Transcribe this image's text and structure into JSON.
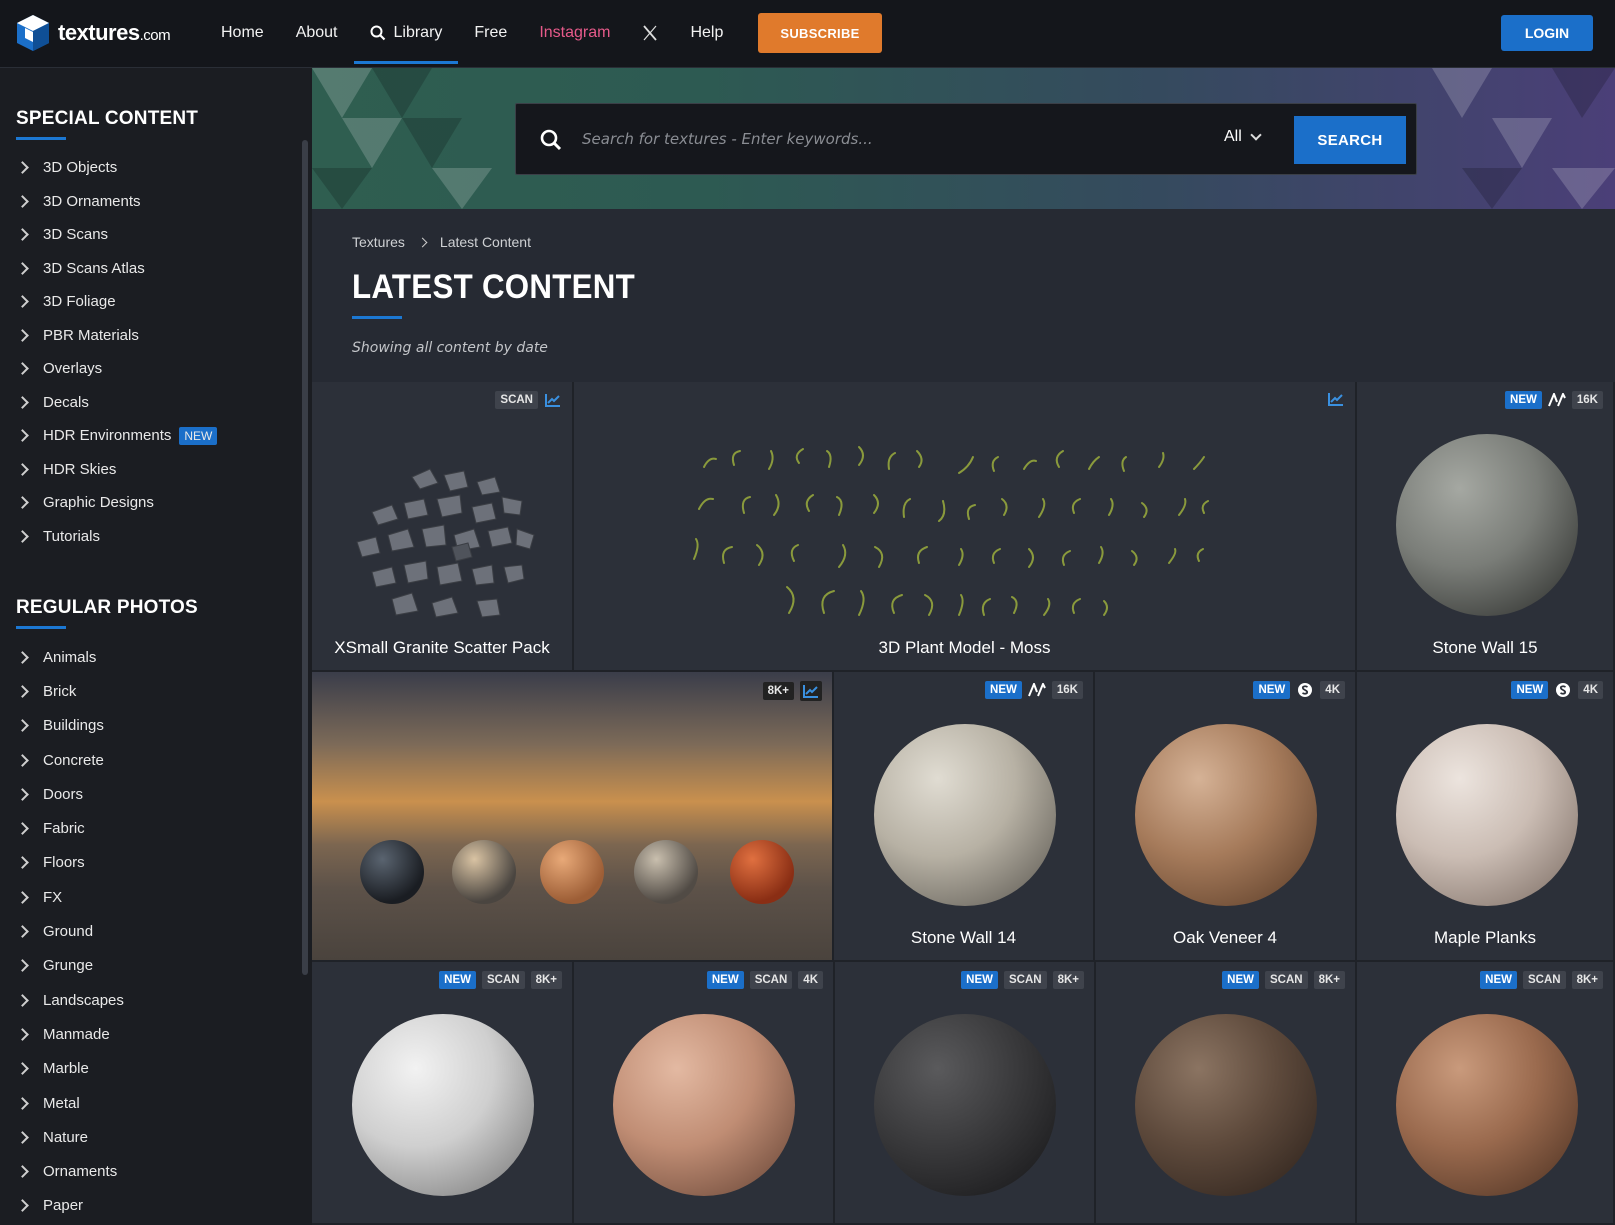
{
  "header": {
    "logo_text": "textures",
    "logo_suffix": ".com",
    "nav": [
      "Home",
      "About",
      "Library",
      "Free",
      "Instagram",
      "X",
      "Help"
    ],
    "subscribe_label": "SUBSCRIBE",
    "login_label": "LOGIN",
    "active_nav": "Library"
  },
  "sidebar": {
    "special_heading": "SPECIAL CONTENT",
    "special_items": [
      "3D Objects",
      "3D Ornaments",
      "3D Scans",
      "3D Scans Atlas",
      "3D Foliage",
      "PBR Materials",
      "Overlays",
      "Decals",
      "HDR Environments",
      "HDR Skies",
      "Graphic Designs",
      "Tutorials"
    ],
    "hdr_env_badge": "NEW",
    "regular_heading": "REGULAR PHOTOS",
    "regular_items": [
      "Animals",
      "Brick",
      "Buildings",
      "Concrete",
      "Doors",
      "Fabric",
      "Floors",
      "FX",
      "Ground",
      "Grunge",
      "Landscapes",
      "Manmade",
      "Marble",
      "Metal",
      "Nature",
      "Ornaments",
      "Paper"
    ]
  },
  "search": {
    "placeholder": "Search for textures - Enter keywords...",
    "scope": "All",
    "button_label": "SEARCH"
  },
  "breadcrumb": [
    "Textures",
    "Latest Content"
  ],
  "page": {
    "title": "LATEST CONTENT",
    "subtitle": "Showing all content by date"
  },
  "cards": [
    {
      "title": "XSmall Granite Scatter Pack",
      "badges": [
        "SCAN"
      ]
    },
    {
      "title": "3D Plant Model - Moss",
      "badges": []
    },
    {
      "title": "Stone Wall 15",
      "badges": [
        "NEW",
        "16K"
      ]
    },
    {
      "title": "",
      "badges": [
        "8K+"
      ]
    },
    {
      "title": "Stone Wall 14",
      "badges": [
        "NEW",
        "16K"
      ]
    },
    {
      "title": "Oak Veneer 4",
      "badges": [
        "NEW",
        "4K"
      ]
    },
    {
      "title": "Maple Planks",
      "badges": [
        "NEW",
        "4K"
      ]
    },
    {
      "title": "",
      "badges": [
        "NEW",
        "SCAN",
        "8K+"
      ]
    },
    {
      "title": "",
      "badges": [
        "NEW",
        "SCAN",
        "4K"
      ]
    },
    {
      "title": "",
      "badges": [
        "NEW",
        "SCAN",
        "8K+"
      ]
    },
    {
      "title": "",
      "badges": [
        "NEW",
        "SCAN",
        "8K+"
      ]
    },
    {
      "title": "",
      "badges": [
        "NEW",
        "SCAN",
        "8K+"
      ]
    }
  ],
  "colors": {
    "accent": "#1c78d3",
    "subscribe": "#e07a2c",
    "instagram": "#e65a8a"
  }
}
